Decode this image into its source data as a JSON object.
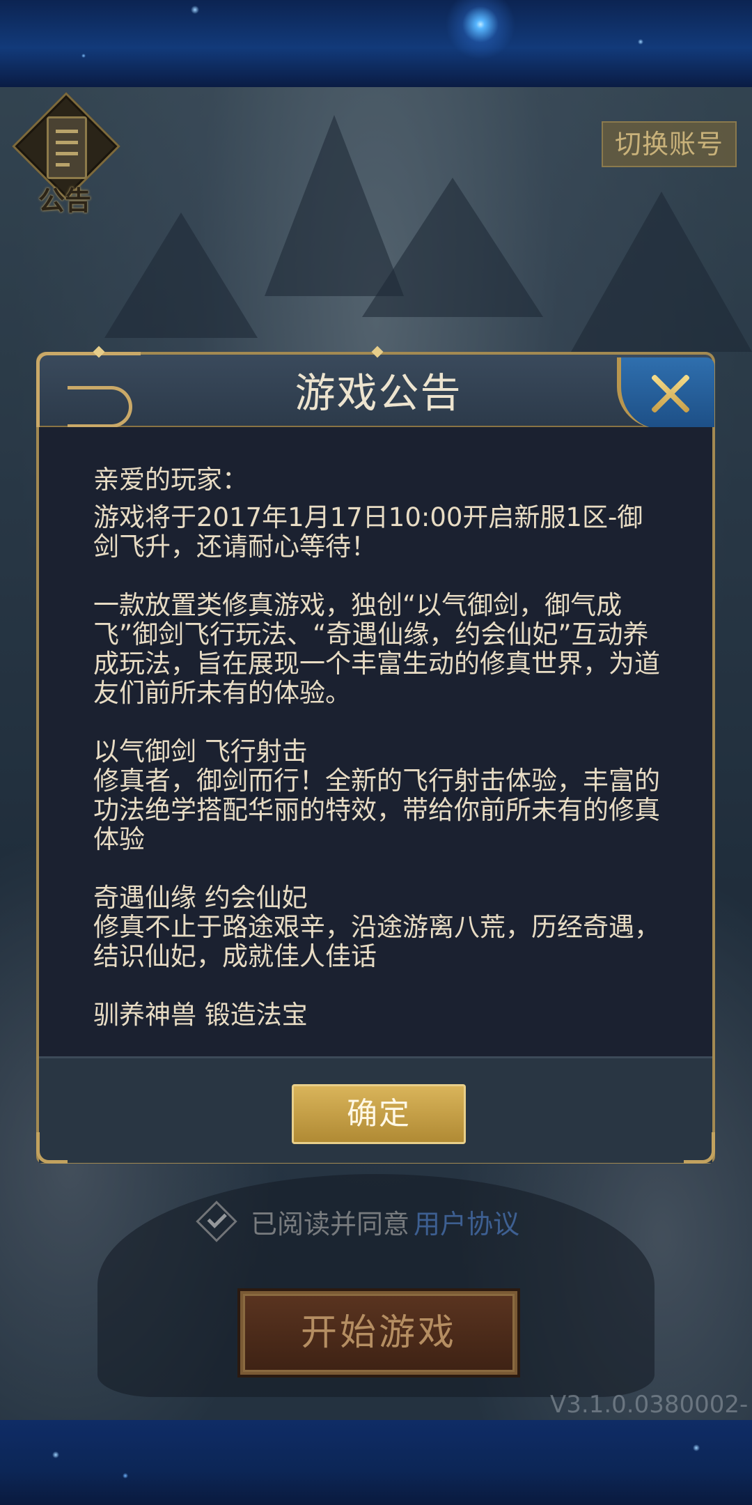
{
  "background": {
    "notice_label": "公告",
    "switch_account_label": "切换账号",
    "agree_text": "已阅读并同意",
    "agree_link": "用户协议",
    "start_game_label": "开始游戏",
    "version_text": "V3.1.0.0380002-"
  },
  "dialog": {
    "title": "游戏公告",
    "greeting": "亲爱的玩家：",
    "paragraphs": [
      "游戏将于2017年1月17日10:00开启新服1区-御剑飞升，还请耐心等待！",
      "一款放置类修真游戏，独创“以气御剑，御气成飞”御剑飞行玩法、“奇遇仙缘，约会仙妃”互动养成玩法，旨在展现一个丰富生动的修真世界，为道友们前所未有的体验。",
      "以气御剑 飞行射击",
      "修真者，御剑而行！全新的飞行射击体验，丰富的功法绝学搭配华丽的特效，带给你前所未有的修真体验",
      "奇遇仙缘 约会仙妃",
      "修真不止于路途艰辛，沿途游离八荒，历经奇遇，结识仙妃，成就佳人佳话",
      "驯养神兽 锻造法宝"
    ],
    "confirm_label": "确定"
  },
  "colors": {
    "dialog_bg": "#1b2130",
    "dialog_border": "#a38a52",
    "text": "#e8dcc4",
    "confirm_bg": "#d9b45a",
    "close_bg": "#2f6fae"
  }
}
